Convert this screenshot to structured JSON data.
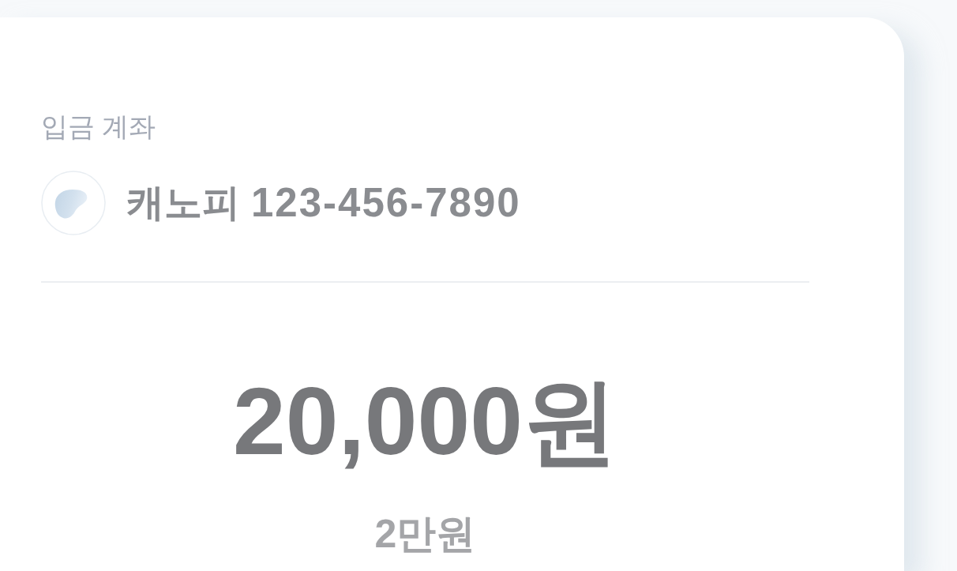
{
  "deposit_account": {
    "label": "입금 계좌",
    "bank_name": "캐노피",
    "account_number": "123-456-7890"
  },
  "amount": {
    "value": "20,000원",
    "in_words": "2만원"
  }
}
